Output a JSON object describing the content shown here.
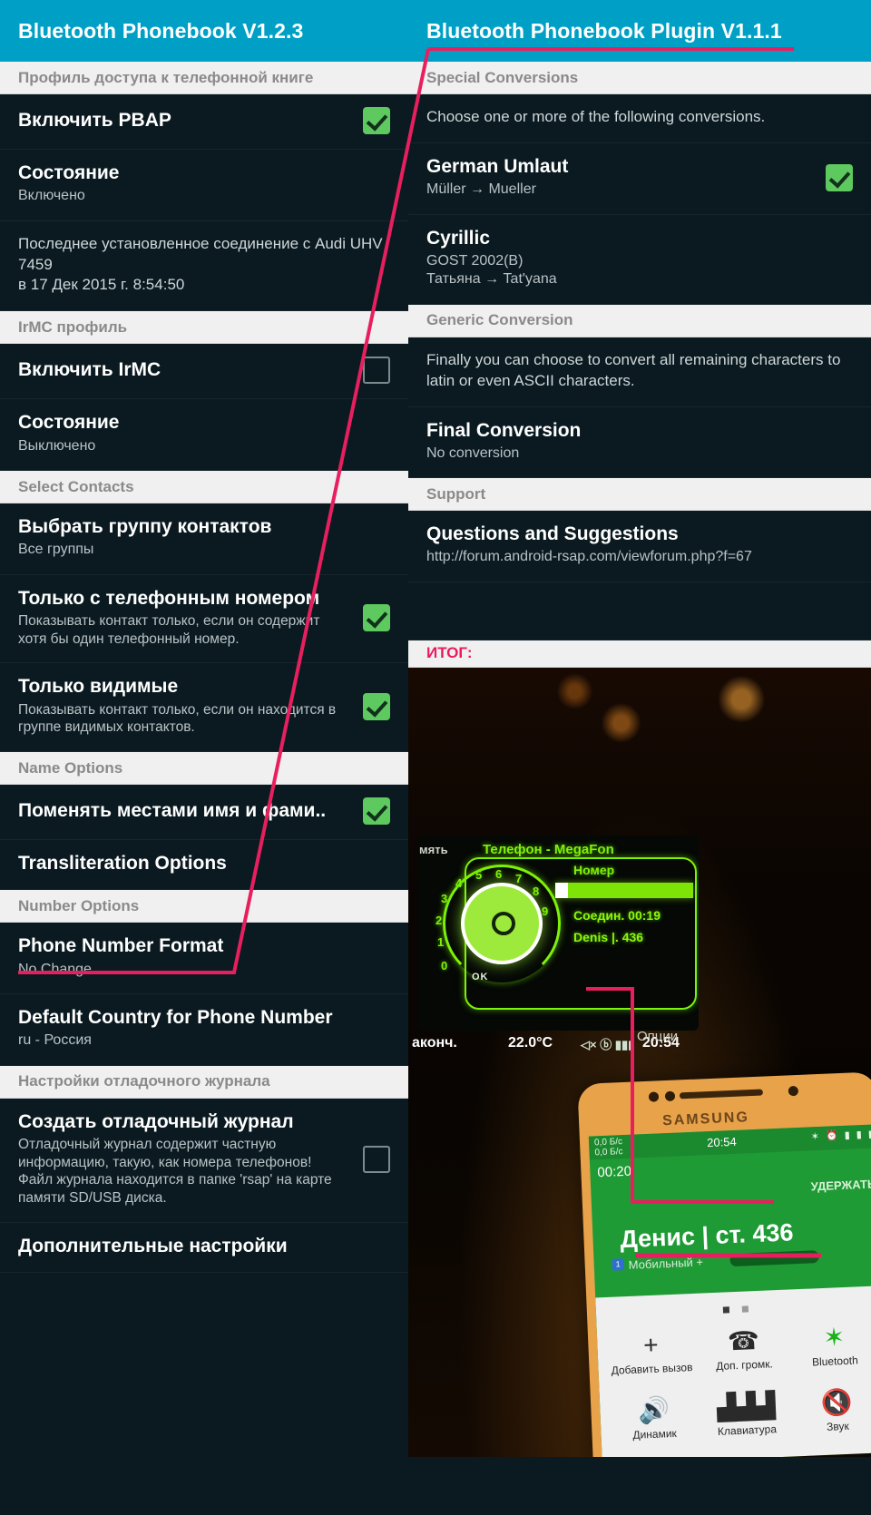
{
  "left_panel": {
    "actionbar_title": "Bluetooth Phonebook V1.2.3",
    "sections": [
      {
        "header": "Профиль доступа к телефонной книге"
      },
      {
        "title": "Включить PBAP",
        "checkbox": "checked"
      },
      {
        "title": "Состояние",
        "sub": "Включено"
      },
      {
        "para": "Последнее установленное соединение с Audi UHV 7459\nв 17 Дек 2015 г. 8:54:50"
      },
      {
        "header": "IrMC профиль"
      },
      {
        "title": "Включить IrMC",
        "checkbox": "unchecked"
      },
      {
        "title": "Состояние",
        "sub": "Выключено"
      },
      {
        "header": "Select Contacts"
      },
      {
        "title": "Выбрать группу контактов",
        "sub": "Все группы"
      },
      {
        "title": "Только с телефонным номером",
        "sub": "Показывать контакт только, если он содержит хотя бы один телефонный номер.",
        "checkbox": "checked"
      },
      {
        "title": "Только видимые",
        "sub": "Показывать контакт только, если он находится в группе видимых контактов.",
        "checkbox": "checked"
      },
      {
        "header": "Name Options"
      },
      {
        "title": "Поменять местами имя и фами..",
        "checkbox": "checked"
      },
      {
        "title": "Transliteration Options",
        "highlighted": true
      },
      {
        "header": "Number Options"
      },
      {
        "title": "Phone Number Format",
        "sub": "No Change"
      },
      {
        "title": "Default Country for Phone Number",
        "sub": "ru - Россия"
      },
      {
        "header": "Настройки отладочного журнала"
      },
      {
        "title": "Создать отладочный журнал",
        "sub": "Отладочный журнал содержит частную информацию, такую, как номера телефонов! Файл журнала находится в папке 'rsap' на карте памяти SD/USB диска.",
        "checkbox": "unchecked"
      },
      {
        "title": "Дополнительные настройки"
      }
    ]
  },
  "right_panel": {
    "actionbar_title": "Bluetooth Phonebook Plugin V1.1.1",
    "section_special": "Special Conversions",
    "intro_special": "Choose one or more of the following conversions.",
    "german": {
      "title": "German Umlaut",
      "sub": "Müller  →  Mueller",
      "checkbox": "checked"
    },
    "cyrillic": {
      "title": "Cyrillic",
      "sub": "GOST 2002(B)\nТатьяна  →  Tat'yana"
    },
    "section_generic": "Generic Conversion",
    "intro_generic": "Finally you can choose to convert all remaining characters to latin or even ASCII characters.",
    "final": {
      "title": "Final Conversion",
      "sub": "No conversion"
    },
    "section_support": "Support",
    "support": {
      "title": "Questions and Suggestions",
      "sub": "http://forum.android-rsap.com/viewforum.php?f=67"
    },
    "result_label": "ИТОГ:"
  },
  "photo": {
    "cluster": {
      "left_word": "мять",
      "title": "Телефон - MegaFon",
      "field_label": "Номер",
      "line_connect": "Соедин. 00:19",
      "line_caller": "Denis |. 436",
      "ok_label": "OK",
      "dial_numbers": [
        "0",
        "1",
        "2",
        "3",
        "4",
        "5",
        "6",
        "7",
        "8",
        "9"
      ],
      "dial_center": "0",
      "status_end": "аконч.",
      "status_temp": "22.0°C",
      "status_time": "20:54",
      "options": "Опции"
    },
    "phone": {
      "brand": "SAMSUNG",
      "data_rate": "0,0 Б/c\n0,0 Б/c",
      "status_time": "20:54",
      "call_timer": "00:20",
      "hold_label": "УДЕРЖАТЬ",
      "caller_name": "Денис | ст. 436",
      "caller_sub": "Мобильный  +",
      "caller_badge": "1",
      "buttons": [
        {
          "icon": "plus-icon",
          "glyph": "+",
          "label": "Добавить вызов"
        },
        {
          "icon": "call-volume-icon",
          "glyph": "📞",
          "label": "Доп. громк."
        },
        {
          "icon": "bluetooth-icon",
          "glyph": "✸",
          "label": "Bluetooth"
        },
        {
          "icon": "speaker-icon",
          "glyph": "🔊",
          "label": "Динамик"
        },
        {
          "icon": "keypad-icon",
          "glyph": "⠿",
          "label": "Клавиатура"
        },
        {
          "icon": "mute-icon",
          "glyph": "🔇",
          "label": "Звук"
        }
      ]
    }
  },
  "colors": {
    "accent": "#00a0c6",
    "annotation": "#e81f5e",
    "checkbox_on": "#5dc95f",
    "section_bg": "#f0f0f0",
    "panel_bg": "#0a1a20"
  }
}
